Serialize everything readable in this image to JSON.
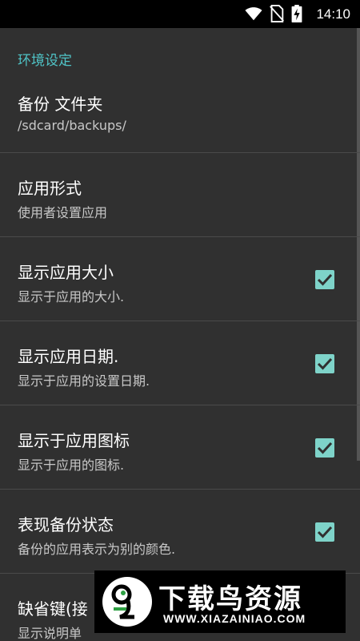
{
  "status_bar": {
    "time": "14:10",
    "icons": [
      "wifi-icon",
      "no-sim-icon",
      "battery-charging-icon"
    ]
  },
  "settings": {
    "section_header": "环境设定",
    "items": [
      {
        "title": "备份 文件夹",
        "summary": "/sdcard/backups/",
        "checkbox": false
      },
      {
        "title": "应用形式",
        "summary": "使用者设置应用",
        "checkbox": false
      },
      {
        "title": "显示应用大小",
        "summary": "显示于应用的大小.",
        "checkbox": true,
        "checked": true
      },
      {
        "title": "显示应用日期.",
        "summary": "显示于应用的设置日期.",
        "checkbox": true,
        "checked": true
      },
      {
        "title": "显示于应用图标",
        "summary": "显示于应用的图标.",
        "checkbox": true,
        "checked": true
      },
      {
        "title": "表现备份状态",
        "summary": "备份的应用表示为别的颜色.",
        "checkbox": true,
        "checked": true
      },
      {
        "title": "缺省键(接",
        "summary": "显示说明单",
        "checkbox": false
      }
    ]
  },
  "watermark": {
    "title": "下载鸟资源",
    "url": "WWW.XIAZAINIAO.COM",
    "logo": "bird-logo-icon"
  },
  "colors": {
    "background": "#303030",
    "accent": "#4fc3c6",
    "checkbox": "#7ed3c9",
    "divider": "#4a4a4a"
  }
}
